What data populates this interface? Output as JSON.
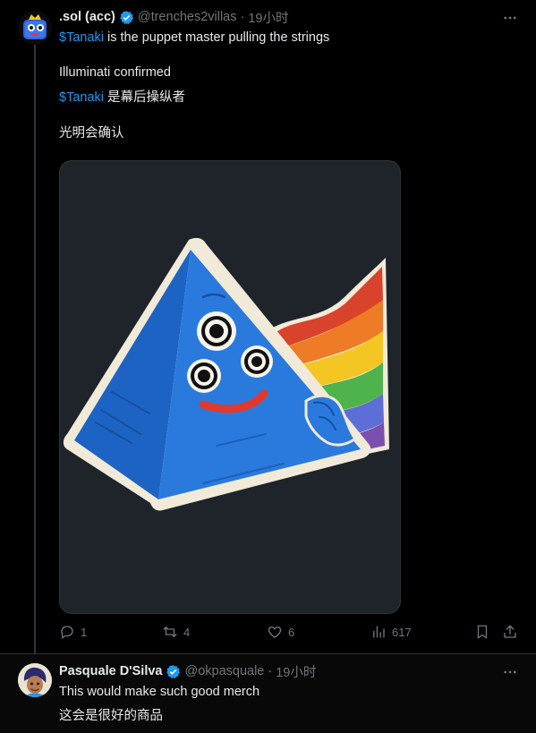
{
  "tweet1": {
    "display_name": ".sol (acc)",
    "handle": "@trenches2villas",
    "separator": "·",
    "time": "19小时",
    "line1_cashtag": "$Tanaki",
    "line1_rest": " is the puppet master pulling the strings",
    "line2": "Illuminati confirmed",
    "line3_cashtag": "$Tanaki",
    "line3_rest": " 是幕后操纵者",
    "line4": "光明会确认",
    "replies": "1",
    "reposts": "4",
    "likes": "6",
    "views": "617"
  },
  "tweet2": {
    "display_name": "Pasquale D'Silva",
    "handle": "@okpasquale",
    "separator": "·",
    "time": "19小时",
    "line1": "This would make such good merch",
    "line2": "这会是很好的商品"
  },
  "colors": {
    "accent": "#1d9bf0",
    "secondary_text": "#71767b",
    "primary_text": "#e7e9ea",
    "background": "#000000"
  },
  "icons": [
    "verified-badge-icon",
    "more-icon",
    "reply-icon",
    "repost-icon",
    "like-icon",
    "views-icon",
    "bookmark-icon",
    "share-icon"
  ]
}
